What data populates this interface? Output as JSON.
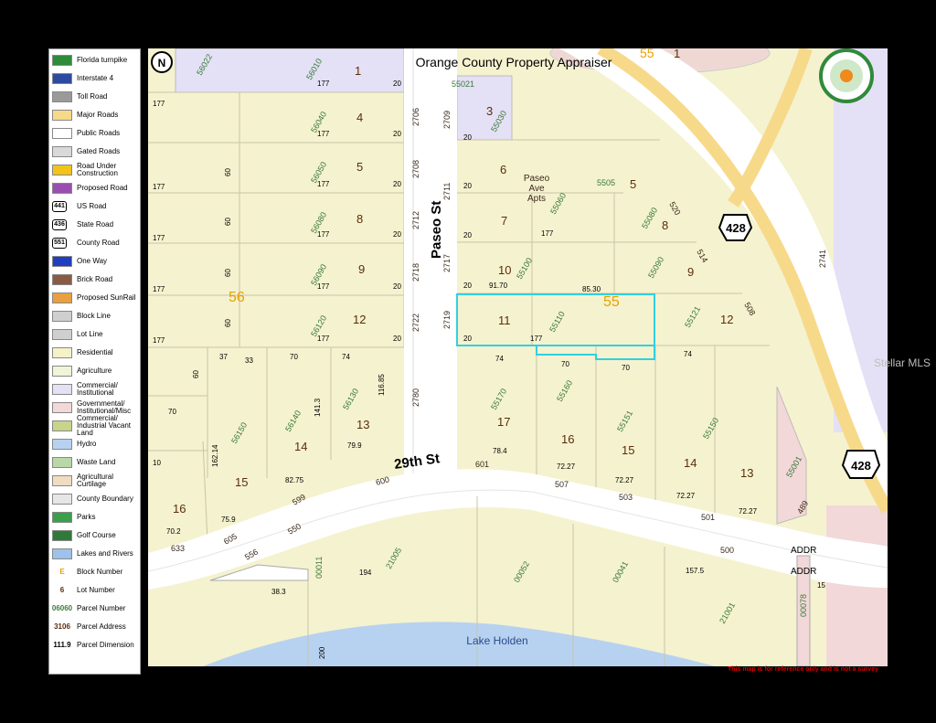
{
  "legend": {
    "items": [
      {
        "label": "Florida turnpike",
        "icon": "turnpike-shield-icon",
        "color": "#2e8b3a"
      },
      {
        "label": "Interstate 4",
        "icon": "interstate-shield-icon",
        "color": "#2c4aa0"
      },
      {
        "label": "Toll Road",
        "icon": "toll-road-icon",
        "color": "#9a9a9a"
      },
      {
        "label": "Major Roads",
        "icon": "major-road-swatch",
        "color": "#f7d98a"
      },
      {
        "label": "Public Roads",
        "icon": "public-road-swatch",
        "color": "#ffffff"
      },
      {
        "label": "Gated Roads",
        "icon": "gated-road-swatch",
        "color": "#d9d9d9"
      },
      {
        "label": "Road Under Construction",
        "icon": "construction-icon",
        "color": "#f0c419"
      },
      {
        "label": "Proposed Road",
        "icon": "proposed-road-swatch",
        "color": "#9a4fb0"
      },
      {
        "label": "US Road",
        "icon": "us-road-shield-icon",
        "glyph": "441"
      },
      {
        "label": "State Road",
        "icon": "state-road-shield-icon",
        "glyph": "436"
      },
      {
        "label": "County Road",
        "icon": "county-road-shield-icon",
        "glyph": "551"
      },
      {
        "label": "One Way",
        "icon": "one-way-arrow-icon",
        "color": "#1f3fbf"
      },
      {
        "label": "Brick Road",
        "icon": "brick-road-swatch",
        "color": "#8a5a44"
      },
      {
        "label": "Proposed SunRail",
        "icon": "sunrail-swatch",
        "color": "#e8a040"
      },
      {
        "label": "Block Line",
        "icon": "block-line-swatch",
        "color": "#cfcfcf"
      },
      {
        "label": "Lot Line",
        "icon": "lot-line-swatch",
        "color": "#cfcfcf"
      },
      {
        "label": "Residential",
        "icon": "residential-swatch",
        "color": "#f5f2c8"
      },
      {
        "label": "Agriculture",
        "icon": "agriculture-swatch",
        "color": "#eef5d8"
      },
      {
        "label": "Commercial/ Institutional",
        "icon": "commercial-swatch",
        "color": "#e4e0f5"
      },
      {
        "label": "Governmental/ Institutional/Misc",
        "icon": "governmental-swatch",
        "color": "#f2d8d8"
      },
      {
        "label": "Commercial/ Industrial Vacant Land",
        "icon": "vacant-land-swatch",
        "color": "#c8d48a"
      },
      {
        "label": "Hydro",
        "icon": "hydro-swatch",
        "color": "#b7d2f0"
      },
      {
        "label": "Waste Land",
        "icon": "waste-land-swatch",
        "color": "#b8d8a8"
      },
      {
        "label": "Agricultural Curtilage",
        "icon": "curtilage-swatch",
        "color": "#f0dcc0"
      },
      {
        "label": "County Boundary",
        "icon": "county-boundary-swatch",
        "color": "#e6e6e6"
      },
      {
        "label": "Parks",
        "icon": "park-tree-icon",
        "color": "#3aa04a"
      },
      {
        "label": "Golf Course",
        "icon": "golf-course-icon",
        "color": "#2f7a3a"
      },
      {
        "label": "Lakes and Rivers",
        "icon": "lake-icon",
        "color": "#9ec2ea"
      },
      {
        "label": "Block Number",
        "icon": "block-number-glyph",
        "glyph": "E",
        "color": "#e8a000"
      },
      {
        "label": "Lot Number",
        "icon": "lot-number-glyph",
        "glyph": "6",
        "color": "#5a2d0c"
      },
      {
        "label": "Parcel Number",
        "icon": "parcel-number-glyph",
        "glyph": "06060",
        "color": "#3a7a3a"
      },
      {
        "label": "Parcel Address",
        "icon": "parcel-address-glyph",
        "glyph": "3106",
        "color": "#5a2d0c"
      },
      {
        "label": "Parcel Dimension",
        "icon": "parcel-dimension-glyph",
        "glyph": "111.9",
        "color": "#000000"
      }
    ]
  },
  "map": {
    "title": "Orange County Property Appraiser",
    "streets": {
      "north_south": "Paseo St",
      "east_west": "29th St"
    },
    "highway_shield": "428",
    "building_label": "Paseo Ave Apts",
    "lake": "Lake Holden",
    "watermark": "Stellar MLS",
    "disclaimer": "This map is for reference only and is not a survey",
    "addr": "ADDR",
    "blocks": [
      "56",
      "55",
      "55"
    ],
    "lots_west": [
      "1",
      "4",
      "5",
      "8",
      "9",
      "12",
      "13",
      "14",
      "15",
      "16"
    ],
    "parcels_west": [
      "56022",
      "56010",
      "56040",
      "56050",
      "56080",
      "56090",
      "56120",
      "56140",
      "56130",
      "56150"
    ],
    "addresses_paseo_west": [
      "2706",
      "2708",
      "2712",
      "2718",
      "2722",
      "2780"
    ],
    "addresses_paseo_east": [
      "2709",
      "2711",
      "2717",
      "2719"
    ],
    "lots_east": [
      "3",
      "6",
      "7",
      "10",
      "11",
      "17",
      "16",
      "15",
      "14",
      "13",
      "8",
      "9",
      "12",
      "5",
      "1"
    ],
    "parcels_east": [
      "55021",
      "55030",
      "55060",
      "55100",
      "55110",
      "55170",
      "55160",
      "55151",
      "55150",
      "55080",
      "55090",
      "55121",
      "55001",
      "5505"
    ],
    "addresses_29th": [
      "633",
      "605",
      "599",
      "600",
      "601",
      "507",
      "503",
      "501",
      "489",
      "550",
      "556",
      "500"
    ],
    "addresses_east": [
      "520",
      "514",
      "508",
      "2741"
    ],
    "dimensions": [
      "177",
      "20",
      "60",
      "91.70",
      "85.30",
      "74",
      "70",
      "37",
      "33",
      "141.3",
      "116.85",
      "79.9",
      "82.75",
      "75.9",
      "70.2",
      "162.14",
      "78.4",
      "72.27",
      "157.5",
      "194",
      "38.3",
      "200",
      "10",
      "15"
    ],
    "parcels_south": [
      "21005",
      "00052",
      "00041",
      "21001",
      "00011",
      "00078"
    ]
  }
}
